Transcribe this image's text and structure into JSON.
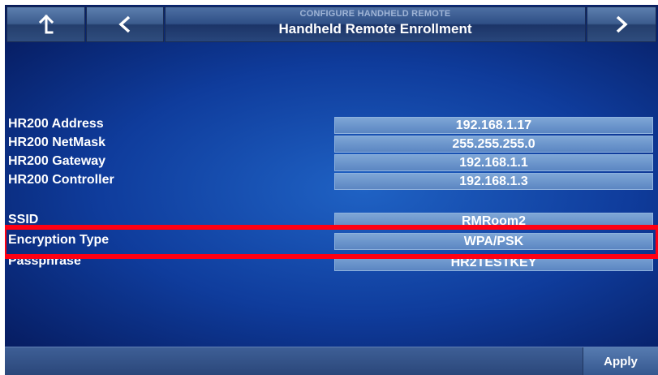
{
  "header": {
    "subtitle": "CONFIGURE HANDHELD REMOTE",
    "title": "Handheld Remote Enrollment",
    "buttons": {
      "up_icon": "up-arrow",
      "back_icon": "chevron-left",
      "next_icon": "chevron-right"
    }
  },
  "fields": [
    {
      "label": "HR200 Address",
      "value": "192.168.1.17"
    },
    {
      "label": "HR200 NetMask",
      "value": "255.255.255.0"
    },
    {
      "label": "HR200 Gateway",
      "value": "192.168.1.1"
    },
    {
      "label": "HR200 Controller",
      "value": "192.168.1.3"
    },
    {
      "label": "SSID",
      "value": "RMRoom2"
    },
    {
      "label": "Encryption Type",
      "value": "WPA/PSK"
    },
    {
      "label": "Passphrase",
      "value": "HR2TESTKEY"
    }
  ],
  "footer": {
    "apply_label": "Apply"
  },
  "colors": {
    "highlight": "#ff0013",
    "background": "#0f3c9c"
  }
}
